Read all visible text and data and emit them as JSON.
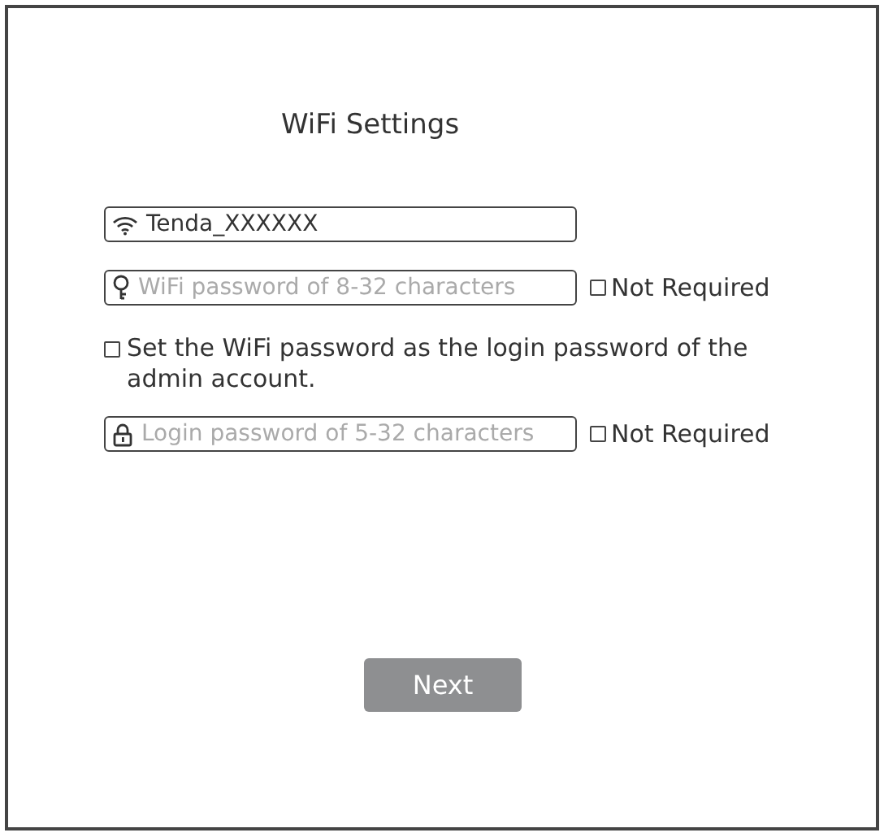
{
  "title": "WiFi Settings",
  "fields": [
    {
      "kind": "wifi",
      "value": "Tenda_XXXXXX"
    },
    {
      "kind": "key",
      "placeholder": "WiFi password of 8-32 characters",
      "option": {
        "label": "Not Required",
        "checked": false
      }
    },
    {
      "kind": "checkbox",
      "label": "Set the WiFi password as the login password of the admin account.",
      "checked": false
    },
    {
      "kind": "lock",
      "placeholder": "Login password of 5-32 characters",
      "option": {
        "label": "Not Required",
        "checked": false
      }
    }
  ],
  "button": "Next"
}
